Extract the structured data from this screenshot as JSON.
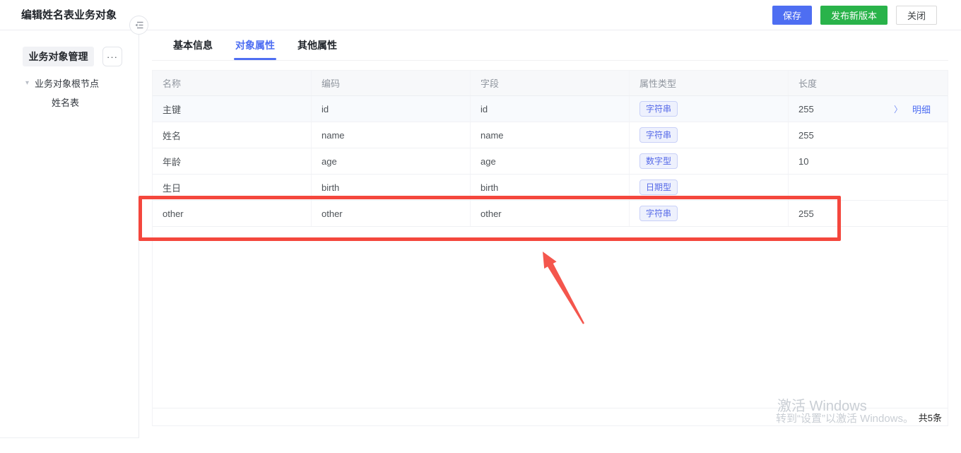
{
  "header": {
    "title": "编辑姓名表业务对象",
    "save_label": "保存",
    "publish_label": "发布新版本",
    "close_label": "关闭"
  },
  "sidebar": {
    "panel_title": "业务对象管理",
    "more_label": "···",
    "root_node": "业务对象根节点",
    "child_node": "姓名表"
  },
  "tabs": {
    "basic": "基本信息",
    "object": "对象属性",
    "other": "其他属性"
  },
  "table": {
    "columns": {
      "name": "名称",
      "code": "编码",
      "field": "字段",
      "type": "属性类型",
      "length": "长度"
    },
    "rows": [
      {
        "name": "主键",
        "code": "id",
        "field": "id",
        "type": "字符串",
        "length": "255",
        "detail": "明细"
      },
      {
        "name": "姓名",
        "code": "name",
        "field": "name",
        "type": "字符串",
        "length": "255"
      },
      {
        "name": "年龄",
        "code": "age",
        "field": "age",
        "type": "数字型",
        "length": "10"
      },
      {
        "name": "生日",
        "code": "birth",
        "field": "birth",
        "type": "日期型",
        "length": ""
      },
      {
        "name": "other",
        "code": "other",
        "field": "other",
        "type": "字符串",
        "length": "255"
      }
    ],
    "total": "共5条"
  },
  "icons": {
    "detail_chevron": "〉",
    "tree_caret": "▾"
  },
  "watermark": {
    "line1": "激活 Windows",
    "line2": "转到“设置”以激活 Windows。"
  },
  "colors": {
    "accent_blue": "#4e6ef2",
    "publish_green": "#29b34a",
    "annotation_red": "#f4473d",
    "badge_text": "#5468e8",
    "badge_bg": "#eef1fd",
    "badge_border": "#c9d1f8"
  }
}
